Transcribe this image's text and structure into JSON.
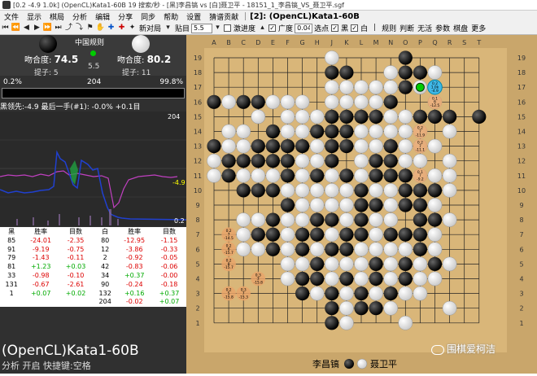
{
  "window": {
    "title": "[0.2 -4.9 1.0k] (OpenCL)Kata1-60B 19 搜索/秒 - [黑]李昌镐 vs [白]聂卫平 - 18151_1_李昌镐_VS_聂卫平.sgf"
  },
  "menu": {
    "items": [
      "文件",
      "显示",
      "棋局",
      "分析",
      "编辑",
      "分享",
      "同步",
      "帮助",
      "设置",
      "猜谱贡献"
    ],
    "engine_label": "[2]: (OpenCL)Kata1-60B"
  },
  "toolbar": {
    "new_game": "新对局",
    "paste": "贴目",
    "komi_value": "5.5",
    "dynamic_komi": "激进度",
    "width_label": "广度",
    "width_value": "0.04",
    "select": "选点",
    "black": "黑",
    "white": "白",
    "rules": "规则",
    "tips": "判断",
    "no_tips": "无活",
    "params": "参数",
    "chessboard": "棋盘",
    "more": "更多"
  },
  "players": {
    "rule": "中国规则",
    "black_fit_label": "吻合度:",
    "black_fit": "74.5",
    "white_fit_label": "吻合度:",
    "white_fit": "80.2",
    "black_captures": "提子: 5",
    "white_captures": "提子: 11",
    "komi": "5.5"
  },
  "winrate": {
    "left": "0.2%",
    "middle": "204",
    "right": "99.8%",
    "black_fraction": 0.002
  },
  "summary": "黑领先:-4.9 最后一手(#1): -0.0% +0.1目",
  "graph": {
    "top_label": "204",
    "right_label": "-4.9",
    "bottom_label": "0.2"
  },
  "stats": {
    "black": {
      "headers": [
        "黑",
        "胜率",
        "目数"
      ],
      "rows": [
        [
          "85",
          "-24.01",
          "-2.35"
        ],
        [
          "91",
          "-9.19",
          "-0.75"
        ],
        [
          "79",
          "-1.43",
          "-0.11"
        ],
        [
          "81",
          "+1.23",
          "+0.03"
        ],
        [
          "33",
          "-0.98",
          "-0.10"
        ],
        [
          "131",
          "-0.67",
          "-2.61"
        ],
        [
          "1",
          "+0.07",
          "+0.02"
        ]
      ]
    },
    "white": {
      "headers": [
        "白",
        "胜率",
        "目数"
      ],
      "rows": [
        [
          "80",
          "-12.95",
          "-1.15"
        ],
        [
          "12",
          "-3.86",
          "-0.33"
        ],
        [
          "2",
          "-0.92",
          "-0.05"
        ],
        [
          "42",
          "-0.83",
          "-0.06"
        ],
        [
          "34",
          "+0.37",
          "-0.00"
        ],
        [
          "90",
          "-0.24",
          "-0.18"
        ],
        [
          "132",
          "+0.16",
          "+0.37"
        ],
        [
          "204",
          "-0.02",
          "+0.07"
        ]
      ]
    }
  },
  "engine_title": "(OpenCL)Kata1-60B",
  "shortcut": "分析 开启 快捷键:空格",
  "board": {
    "columns": [
      "A",
      "B",
      "C",
      "D",
      "E",
      "F",
      "G",
      "H",
      "J",
      "K",
      "L",
      "M",
      "N",
      "O",
      "P",
      "Q",
      "R",
      "S",
      "T"
    ],
    "rows": [
      "19",
      "18",
      "17",
      "16",
      "15",
      "14",
      "13",
      "12",
      "11",
      "10",
      "9",
      "8",
      "7",
      "6",
      "5",
      "4",
      "3",
      "2",
      "1"
    ],
    "black_player": "李昌镐",
    "white_player": "聂卫平",
    "black_stones": [
      "O19",
      "J18",
      "K18",
      "O18",
      "P18",
      "O17",
      "A16",
      "C16",
      "D16",
      "N16",
      "M15",
      "P15",
      "Q15",
      "R15",
      "T15",
      "D15",
      "J15",
      "K15",
      "L15",
      "E14",
      "H14",
      "J14",
      "K14",
      "A13",
      "D13",
      "E13",
      "F13",
      "G13",
      "J13",
      "K13",
      "N13",
      "B12",
      "C12",
      "D12",
      "E12",
      "F12",
      "J12",
      "M12",
      "N12",
      "B11",
      "F11",
      "H11",
      "K11",
      "M11",
      "N11",
      "O11",
      "C10",
      "D10",
      "E10",
      "L10",
      "O10",
      "P10",
      "Q10",
      "F9",
      "L9",
      "M9",
      "O9",
      "P9",
      "E8",
      "H8",
      "J8",
      "L8",
      "P8",
      "Q8",
      "D7",
      "E7",
      "G7",
      "H7",
      "K7",
      "L7",
      "N7",
      "O7",
      "P7",
      "E6",
      "G6",
      "J6",
      "K6",
      "P6",
      "H5",
      "M5",
      "O5",
      "Q5",
      "G4",
      "H4",
      "K4",
      "M4",
      "O4",
      "G3",
      "J3",
      "L3",
      "N3",
      "J2",
      "L2",
      "M2",
      "J1"
    ],
    "white_stones": [
      "J19",
      "N18",
      "Q18",
      "J17",
      "K17",
      "L17",
      "M17",
      "N17",
      "P17",
      "B16",
      "E16",
      "F16",
      "G16",
      "J16",
      "K16",
      "L16",
      "M16",
      "Q16",
      "D15",
      "F15",
      "G15",
      "H15",
      "N15",
      "O15",
      "R14",
      "B14",
      "C14",
      "F14",
      "G14",
      "L14",
      "M14",
      "N14",
      "O14",
      "P14",
      "B13",
      "C13",
      "H13",
      "L13",
      "M13",
      "O13",
      "P13",
      "Q13",
      "A12",
      "G12",
      "H12",
      "L12",
      "O12",
      "P12",
      "R12",
      "A11",
      "C11",
      "D11",
      "E11",
      "G11",
      "J11",
      "L11",
      "P11",
      "Q11",
      "R11",
      "F10",
      "G10",
      "H10",
      "J10",
      "K10",
      "M10",
      "N10",
      "R10",
      "G9",
      "H9",
      "J9",
      "K9",
      "N9",
      "Q9",
      "C8",
      "D8",
      "F8",
      "G8",
      "K8",
      "M8",
      "N8",
      "R8",
      "C7",
      "F7",
      "J7",
      "M7",
      "Q7",
      "C6",
      "D6",
      "F6",
      "H6",
      "L6",
      "M6",
      "N6",
      "O6",
      "Q6",
      "F5",
      "G5",
      "J5",
      "K5",
      "L5",
      "N5",
      "P5",
      "R5",
      "F4",
      "J4",
      "L4",
      "N4",
      "P4",
      "Q4",
      "H3",
      "K3",
      "M3",
      "O3",
      "P3",
      "K2",
      "N2",
      "R2",
      "K1",
      "O1"
    ],
    "analysis_marks": [
      {
        "pos": "Q17",
        "line1": "0.2",
        "line2": "1.0k",
        "line3": "-4.9",
        "best": true
      },
      {
        "pos": "Q16",
        "line1": "0.1",
        "line2": "6",
        "line3": "-12.5",
        "best": false
      },
      {
        "pos": "P14",
        "line1": "0.2",
        "line2": "7",
        "line3": "-11.9",
        "best": false
      },
      {
        "pos": "P13",
        "line1": "0.2",
        "line2": "7",
        "line3": "-11.1",
        "best": false
      },
      {
        "pos": "P11",
        "line1": "0.1",
        "line2": "7",
        "line3": "-9.2",
        "best": false
      },
      {
        "pos": "B7",
        "line1": "0.2",
        "line2": "7",
        "line3": "-14.5",
        "best": false
      },
      {
        "pos": "B6",
        "line1": "0.2",
        "line2": "6",
        "line3": "-15.7",
        "best": false
      },
      {
        "pos": "B5",
        "line1": "0.2",
        "line2": "8",
        "line3": "-15.7",
        "best": false
      },
      {
        "pos": "B3",
        "line1": "0.2",
        "line2": "5",
        "line3": "-15.8",
        "best": false
      },
      {
        "pos": "C3",
        "line1": "0.3",
        "line2": "7",
        "line3": "-15.3",
        "best": false
      },
      {
        "pos": "D4",
        "line1": "0.3",
        "line2": "7",
        "line3": "-15.8",
        "best": false
      }
    ],
    "last_move_marker": "P17"
  },
  "watermark": "围棋爱柯洁",
  "colors": {
    "board": "#d9b679",
    "panel": "#303030",
    "best_move": "#3fb8e8",
    "candidate": "#e8a56a"
  }
}
